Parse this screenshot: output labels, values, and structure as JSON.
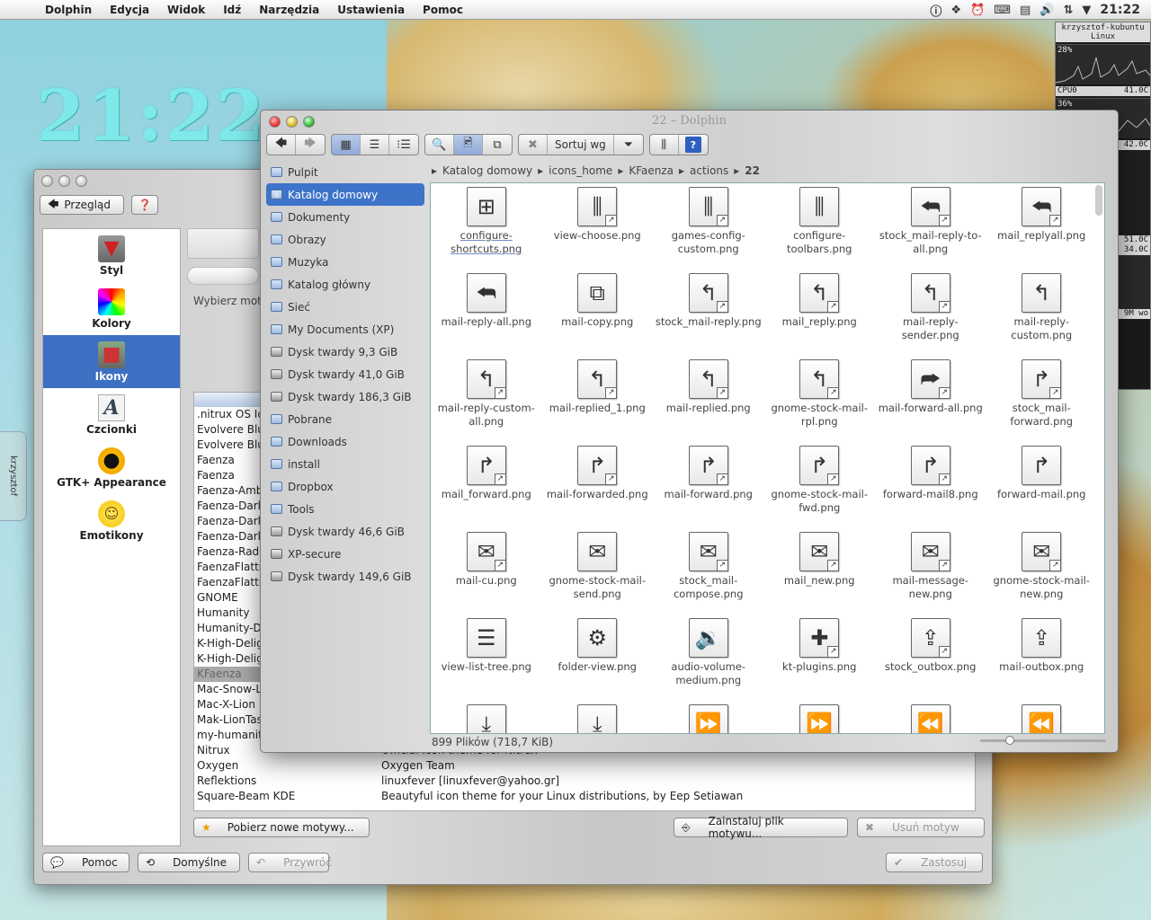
{
  "menubar": {
    "app": "Dolphin",
    "items": [
      "Edycja",
      "Widok",
      "Idź",
      "Narzędzia",
      "Ustawienia",
      "Pomoc"
    ],
    "clock": "21:22"
  },
  "desktop": {
    "clock": "21:22",
    "side_tab": "krzysztof"
  },
  "sysmon": {
    "host": "krzysztof-kubuntu",
    "os": "Linux",
    "cpu0_pct": "28%",
    "cpu0_label": "CPU0",
    "cpu0_temp": "41.0C",
    "cpu1_pct": "36%",
    "temp2": "42.0C",
    "temp3": "51.0C",
    "temp4": "34.0C",
    "label_cut": "9M wo"
  },
  "settings": {
    "back_label": "Przegląd",
    "prompt": "Wybierz mot",
    "categories": [
      {
        "label": "Styl",
        "icon": "tie-icon"
      },
      {
        "label": "Kolory",
        "icon": "color-palette-icon"
      },
      {
        "label": "Ikony",
        "icon": "icons-icon",
        "selected": true
      },
      {
        "label": "Czcionki",
        "icon": "font-icon"
      },
      {
        "label": "GTK+ Appearance",
        "icon": "gnome-foot-icon"
      },
      {
        "label": "Emotikony",
        "icon": "smiley-icon"
      }
    ],
    "themes": [
      {
        "name": ".nitrux OS Ic",
        "desc": ""
      },
      {
        "name": "Evolvere Blu",
        "desc": ""
      },
      {
        "name": "Evolvere Blu",
        "desc": ""
      },
      {
        "name": "Faenza",
        "desc": ""
      },
      {
        "name": "Faenza",
        "desc": ""
      },
      {
        "name": "Faenza-Amb",
        "desc": ""
      },
      {
        "name": "Faenza-Dark",
        "desc": ""
      },
      {
        "name": "Faenza-Dark",
        "desc": ""
      },
      {
        "name": "Faenza-Dark",
        "desc": ""
      },
      {
        "name": "Faenza-Radi",
        "desc": ""
      },
      {
        "name": "FaenzaFlattr",
        "desc": ""
      },
      {
        "name": "FaenzaFlattr",
        "desc": ""
      },
      {
        "name": "GNOME",
        "desc": ""
      },
      {
        "name": "Humanity",
        "desc": ""
      },
      {
        "name": "Humanity-D",
        "desc": ""
      },
      {
        "name": "K-High-Deligi",
        "desc": ""
      },
      {
        "name": "K-High-Delig",
        "desc": ""
      },
      {
        "name": "KFaenza",
        "desc": "",
        "selected": true
      },
      {
        "name": "Mac-Snow-L",
        "desc": ""
      },
      {
        "name": "Mac-X-Lion",
        "desc": ""
      },
      {
        "name": "Mak-LionTas",
        "desc": ""
      },
      {
        "name": "my-humanit",
        "desc": ""
      },
      {
        "name": "Nitrux",
        "desc": "Official icon theme for Nitrux"
      },
      {
        "name": "Oxygen",
        "desc": "Oxygen Team"
      },
      {
        "name": "Reflektions",
        "desc": "linuxfever [linuxfever@yahoo.gr]"
      },
      {
        "name": "Square-Beam KDE",
        "desc": "Beautyful icon theme for your Linux distributions, by Eep Setiawan"
      }
    ],
    "get_new": "Pobierz nowe motywy...",
    "install_file": "Zainstaluj plik motywu...",
    "remove": "Usuń motyw",
    "help": "Pomoc",
    "defaults": "Domyślne",
    "reset": "Przywróć",
    "apply": "Zastosuj"
  },
  "dolphin": {
    "title": "22 – Dolphin",
    "sort_label": "Sortuj wg",
    "places": [
      {
        "label": "Pulpit",
        "icon": "folder-icon"
      },
      {
        "label": "Katalog domowy",
        "icon": "home-icon",
        "selected": true
      },
      {
        "label": "Dokumenty",
        "icon": "folder-icon"
      },
      {
        "label": "Obrazy",
        "icon": "folder-icon"
      },
      {
        "label": "Muzyka",
        "icon": "folder-icon"
      },
      {
        "label": "Katalog główny",
        "icon": "folder-icon"
      },
      {
        "label": "Sieć",
        "icon": "folder-icon"
      },
      {
        "label": "My Documents (XP)",
        "icon": "folder-icon"
      },
      {
        "label": "Dysk twardy 9,3 GiB",
        "icon": "disk-icon"
      },
      {
        "label": "Dysk twardy 41,0 GiB",
        "icon": "disk-icon"
      },
      {
        "label": "Dysk twardy 186,3 GiB",
        "icon": "disk-icon"
      },
      {
        "label": "Pobrane",
        "icon": "folder-icon"
      },
      {
        "label": "Downloads",
        "icon": "folder-icon"
      },
      {
        "label": "install",
        "icon": "folder-icon"
      },
      {
        "label": "Dropbox",
        "icon": "folder-icon"
      },
      {
        "label": "Tools",
        "icon": "folder-icon"
      },
      {
        "label": "Dysk twardy 46,6 GiB",
        "icon": "disk-icon"
      },
      {
        "label": "XP-secure",
        "icon": "disk-icon"
      },
      {
        "label": "Dysk twardy 149,6 GiB",
        "icon": "disk-icon"
      }
    ],
    "breadcrumb": [
      "Katalog domowy",
      "icons_home",
      "KFaenza",
      "actions"
    ],
    "breadcrumb_current": "22",
    "files": [
      {
        "name": "configure-shortcuts.png",
        "glyph": "⊞",
        "link": false
      },
      {
        "name": "view-choose.png",
        "glyph": "⫼",
        "link": true
      },
      {
        "name": "games-config-custom.png",
        "glyph": "⫼",
        "link": true
      },
      {
        "name": "configure-toolbars.png",
        "glyph": "⫼",
        "link": false
      },
      {
        "name": "stock_mail-reply-to-all.png",
        "glyph": "⮪",
        "link": true
      },
      {
        "name": "mail_replyall.png",
        "glyph": "⮪",
        "link": true
      },
      {
        "name": "mail-reply-all.png",
        "glyph": "⮪",
        "link": false
      },
      {
        "name": "mail-copy.png",
        "glyph": "⧉",
        "link": false
      },
      {
        "name": "stock_mail-reply.png",
        "glyph": "↰",
        "link": true
      },
      {
        "name": "mail_reply.png",
        "glyph": "↰",
        "link": true
      },
      {
        "name": "mail-reply-sender.png",
        "glyph": "↰",
        "link": true
      },
      {
        "name": "mail-reply-custom.png",
        "glyph": "↰",
        "link": false
      },
      {
        "name": "mail-reply-custom-all.png",
        "glyph": "↰",
        "link": true
      },
      {
        "name": "mail-replied_1.png",
        "glyph": "↰",
        "link": true
      },
      {
        "name": "mail-replied.png",
        "glyph": "↰",
        "link": true
      },
      {
        "name": "gnome-stock-mail-rpl.png",
        "glyph": "↰",
        "link": true
      },
      {
        "name": "mail-forward-all.png",
        "glyph": "⮫",
        "link": true
      },
      {
        "name": "stock_mail-forward.png",
        "glyph": "↱",
        "link": true
      },
      {
        "name": "mail_forward.png",
        "glyph": "↱",
        "link": true
      },
      {
        "name": "mail-forwarded.png",
        "glyph": "↱",
        "link": true
      },
      {
        "name": "mail-forward.png",
        "glyph": "↱",
        "link": true
      },
      {
        "name": "gnome-stock-mail-fwd.png",
        "glyph": "↱",
        "link": true
      },
      {
        "name": "forward-mail8.png",
        "glyph": "↱",
        "link": true
      },
      {
        "name": "forward-mail.png",
        "glyph": "↱",
        "link": false
      },
      {
        "name": "mail-cu.png",
        "glyph": "✉",
        "link": true
      },
      {
        "name": "gnome-stock-mail-send.png",
        "glyph": "✉",
        "link": false
      },
      {
        "name": "stock_mail-compose.png",
        "glyph": "✉",
        "link": true
      },
      {
        "name": "mail_new.png",
        "glyph": "✉",
        "link": true
      },
      {
        "name": "mail-message-new.png",
        "glyph": "✉",
        "link": true
      },
      {
        "name": "gnome-stock-mail-new.png",
        "glyph": "✉",
        "link": true
      },
      {
        "name": "view-list-tree.png",
        "glyph": "☰",
        "link": false
      },
      {
        "name": "folder-view.png",
        "glyph": "⚙",
        "link": false
      },
      {
        "name": "audio-volume-medium.png",
        "glyph": "🔉",
        "link": false
      },
      {
        "name": "kt-plugins.png",
        "glyph": "✚",
        "link": true
      },
      {
        "name": "stock_outbox.png",
        "glyph": "⇪",
        "link": true
      },
      {
        "name": "mail-outbox.png",
        "glyph": "⇪",
        "link": false
      },
      {
        "name": "",
        "glyph": "⤓",
        "link": false
      },
      {
        "name": "",
        "glyph": "⤓",
        "link": false
      },
      {
        "name": "",
        "glyph": "⏩",
        "link": false
      },
      {
        "name": "",
        "glyph": "⏩",
        "link": false
      },
      {
        "name": "",
        "glyph": "⏪",
        "link": false
      },
      {
        "name": "",
        "glyph": "⏪",
        "link": false
      }
    ],
    "status": "899 Plików (718,7 KiB)"
  }
}
